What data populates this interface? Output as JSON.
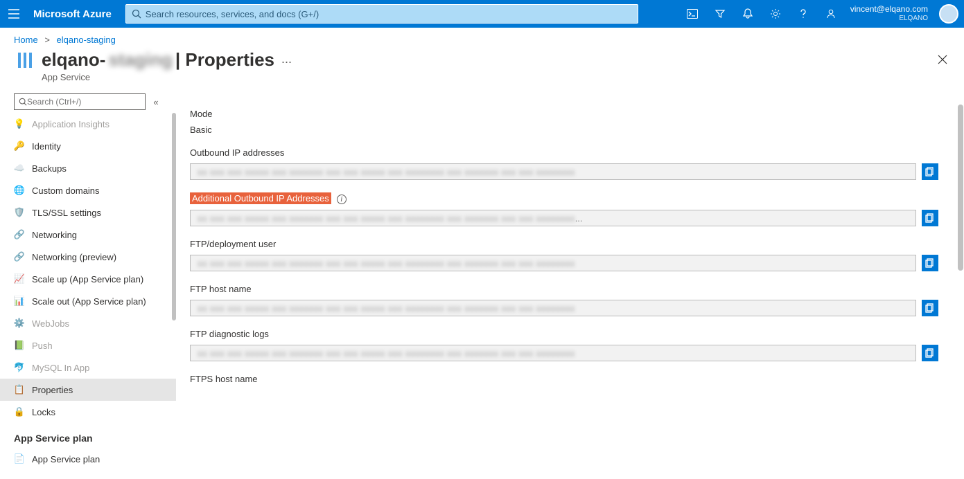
{
  "header": {
    "brand": "Microsoft Azure",
    "search_placeholder": "Search resources, services, and docs (G+/)",
    "user_email": "vincent@elqano.com",
    "tenant": "ELQANO"
  },
  "breadcrumb": {
    "home": "Home",
    "current": "elqano-staging"
  },
  "page": {
    "title_prefix": "elqano-",
    "title_blur": "staging",
    "title_suffix": " | Properties",
    "subtitle": "App Service",
    "more": "...",
    "sidebar_search_placeholder": "Search (Ctrl+/)"
  },
  "sidebar": {
    "items": [
      {
        "label": "Application Insights",
        "icon": "💡",
        "disabled": true
      },
      {
        "label": "Identity",
        "icon": "🔑"
      },
      {
        "label": "Backups",
        "icon": "☁️"
      },
      {
        "label": "Custom domains",
        "icon": "🌐"
      },
      {
        "label": "TLS/SSL settings",
        "icon": "🛡️"
      },
      {
        "label": "Networking",
        "icon": "🔗"
      },
      {
        "label": "Networking (preview)",
        "icon": "🔗"
      },
      {
        "label": "Scale up (App Service plan)",
        "icon": "📈"
      },
      {
        "label": "Scale out (App Service plan)",
        "icon": "📊"
      },
      {
        "label": "WebJobs",
        "icon": "⚙️",
        "disabled": true
      },
      {
        "label": "Push",
        "icon": "📗",
        "disabled": true
      },
      {
        "label": "MySQL In App",
        "icon": "🐬",
        "disabled": true
      },
      {
        "label": "Properties",
        "icon": "📋",
        "selected": true
      },
      {
        "label": "Locks",
        "icon": "🔒"
      }
    ],
    "section2_title": "App Service plan",
    "section2_items": [
      {
        "label": "App Service plan",
        "icon": "📄"
      }
    ]
  },
  "content": {
    "mode_label": "Mode",
    "mode_value": "Basic",
    "fields": [
      {
        "label": "Outbound IP addresses",
        "value_masked": true
      },
      {
        "label": "Additional Outbound IP Addresses",
        "highlight": true,
        "info": true,
        "value_masked": true,
        "ellipsis": true
      },
      {
        "label": "FTP/deployment user",
        "value_masked": true
      },
      {
        "label": "FTP host name",
        "value_masked": true
      },
      {
        "label": "FTP diagnostic logs",
        "value_masked": true
      },
      {
        "label": "FTPS host name",
        "no_box": true
      }
    ]
  }
}
